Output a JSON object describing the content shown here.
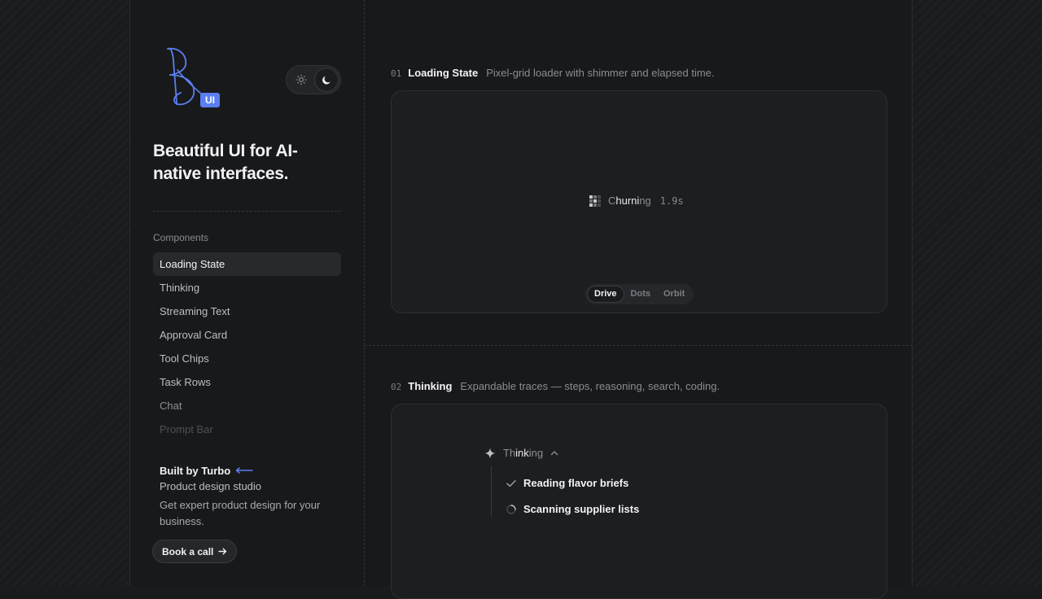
{
  "brand": {
    "logo_badge": "UI",
    "tagline": "Beautiful UI for AI-native interfaces."
  },
  "theme_toggle": {
    "options": [
      "light",
      "dark"
    ],
    "selected": "dark"
  },
  "sidebar": {
    "heading": "Components",
    "items": [
      {
        "label": "Loading State",
        "active": true
      },
      {
        "label": "Thinking"
      },
      {
        "label": "Streaming Text"
      },
      {
        "label": "Approval Card"
      },
      {
        "label": "Tool Chips"
      },
      {
        "label": "Task Rows"
      },
      {
        "label": "Chat"
      },
      {
        "label": "Prompt Bar"
      }
    ]
  },
  "promo": {
    "title": "Built by Turbo",
    "subtitle": "Product design studio",
    "description": "Get expert product design for your business.",
    "cta": "Book a call"
  },
  "sections": [
    {
      "number": "01",
      "title": "Loading State",
      "description": "Pixel-grid loader with shimmer and elapsed time.",
      "loader": {
        "text_before": "C",
        "text_shine": "hurni",
        "text_after": "ng",
        "elapsed": "1.9s"
      },
      "variants": [
        "Drive",
        "Dots",
        "Orbit"
      ],
      "selected_variant": "Drive"
    },
    {
      "number": "02",
      "title": "Thinking",
      "description": "Expandable traces — steps, reasoning, search, coding.",
      "thinking": {
        "label_before": "Th",
        "label_shine": "ink",
        "label_after": "ing",
        "steps": [
          {
            "label": "Reading flavor briefs",
            "status": "done"
          },
          {
            "label": "Scanning supplier lists",
            "status": "in-progress"
          }
        ]
      }
    }
  ],
  "colors": {
    "accent": "#5b7ff0",
    "background": "#18191b"
  }
}
